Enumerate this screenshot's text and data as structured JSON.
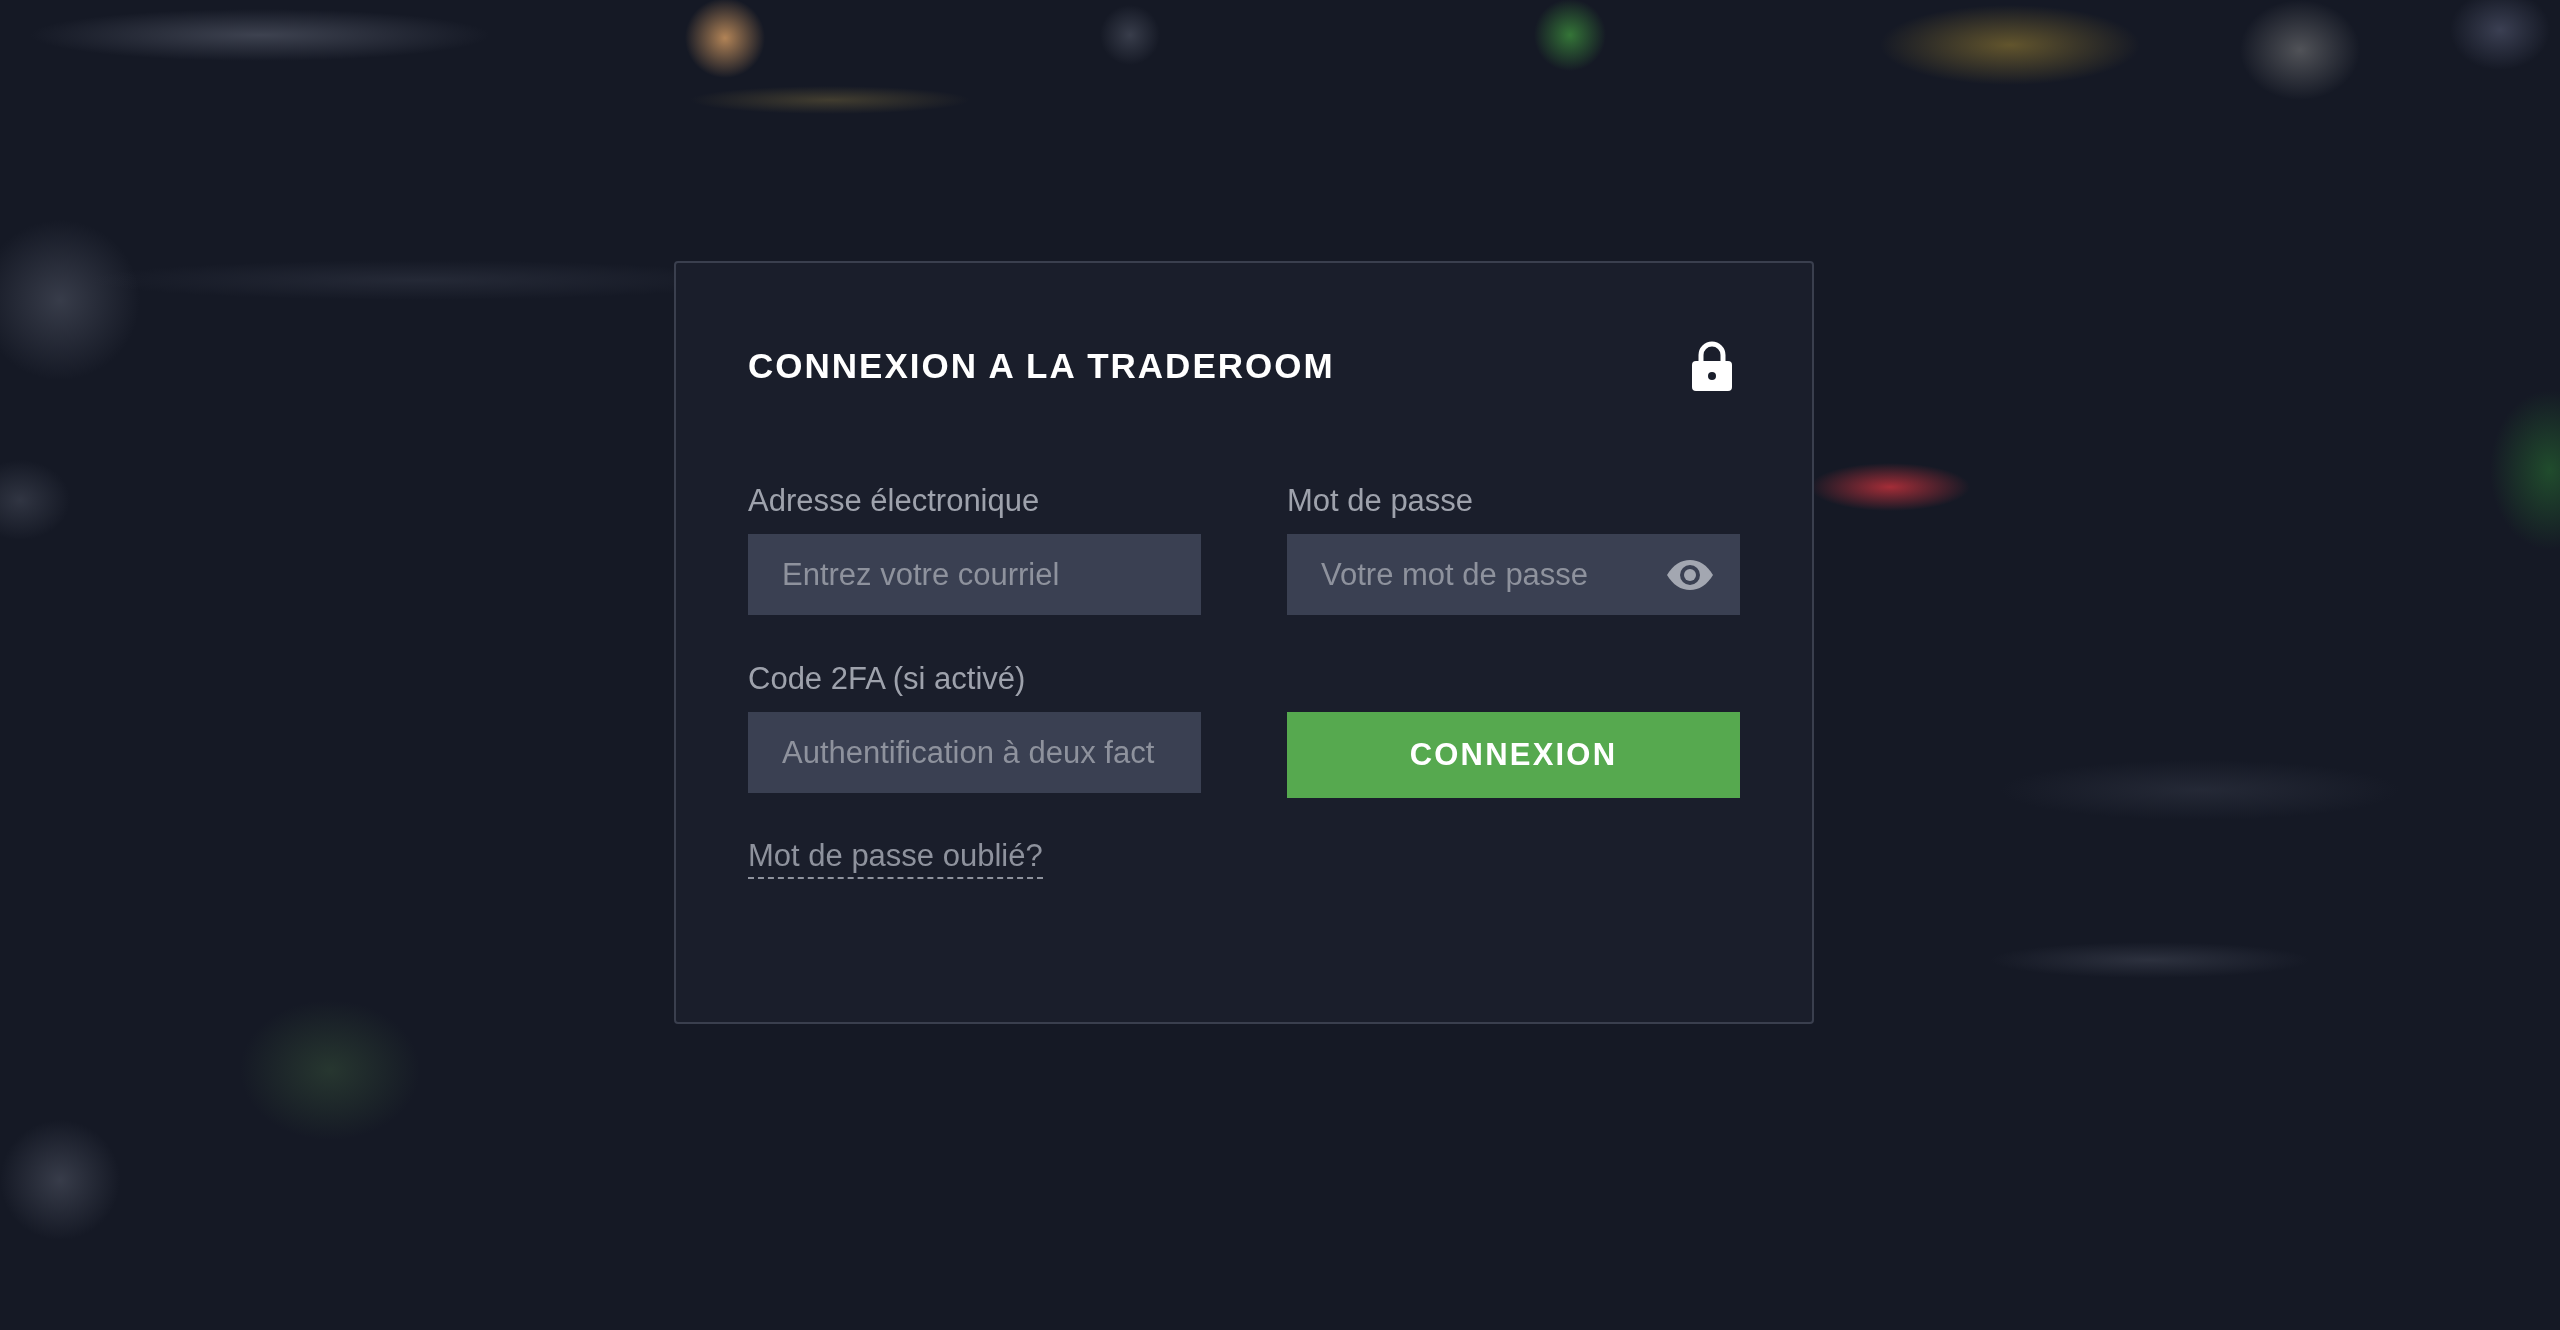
{
  "dialog": {
    "title": "CONNEXION A LA TRADEROOM",
    "fields": [
      {
        "kind": "text",
        "label": "Adresse électronique",
        "placeholder": "Entrez votre courriel"
      },
      {
        "kind": "password",
        "label": "Mot de passe",
        "placeholder": "Votre mot de passe"
      },
      {
        "kind": "text",
        "label": "Code 2FA (si activé)",
        "placeholder": "Authentification à deux fact"
      }
    ],
    "submit_button": "CONNEXION",
    "forgot_password_link": "Mot de passe oublié?"
  }
}
